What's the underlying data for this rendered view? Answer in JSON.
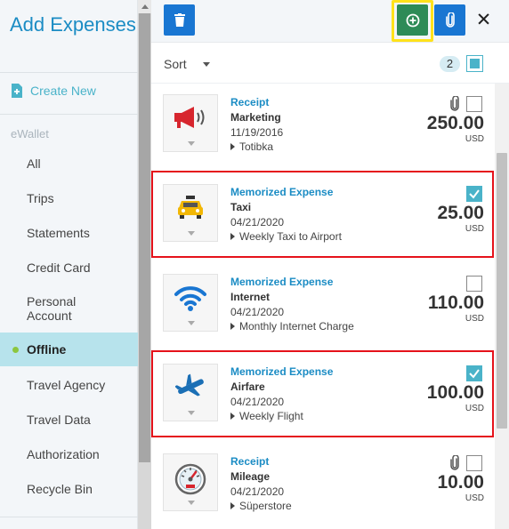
{
  "sidebar": {
    "title": "Add Expenses",
    "create_new": "Create New",
    "section": "eWallet",
    "items": [
      {
        "label": "All"
      },
      {
        "label": "Trips"
      },
      {
        "label": "Statements"
      },
      {
        "label": "Credit Card"
      },
      {
        "label": "Personal Account"
      },
      {
        "label": "Offline",
        "active": true
      },
      {
        "label": "Travel Agency"
      },
      {
        "label": "Travel Data"
      },
      {
        "label": "Authorization"
      },
      {
        "label": "Recycle Bin"
      }
    ]
  },
  "toolbar": {
    "icons": [
      "trash-icon",
      "add-icon",
      "paperclip-icon",
      "close-icon"
    ],
    "close_glyph": "✕"
  },
  "sortbar": {
    "sort_label": "Sort",
    "selected_count": "2"
  },
  "expenses": [
    {
      "type": "Receipt",
      "name": "Marketing",
      "date": "11/19/2016",
      "detail": "Totibka",
      "amount": "250.00",
      "currency": "USD",
      "checked": false,
      "attachment": true,
      "icon": "megaphone-icon"
    },
    {
      "type": "Memorized Expense",
      "name": "Taxi",
      "date": "04/21/2020",
      "detail": "Weekly Taxi to Airport",
      "amount": "25.00",
      "currency": "USD",
      "checked": true,
      "attachment": false,
      "icon": "taxi-icon"
    },
    {
      "type": "Memorized Expense",
      "name": "Internet",
      "date": "04/21/2020",
      "detail": "Monthly Internet Charge",
      "amount": "110.00",
      "currency": "USD",
      "checked": false,
      "attachment": false,
      "icon": "wifi-icon"
    },
    {
      "type": "Memorized Expense",
      "name": "Airfare",
      "date": "04/21/2020",
      "detail": "Weekly Flight",
      "amount": "100.00",
      "currency": "USD",
      "checked": true,
      "attachment": false,
      "icon": "airplane-icon"
    },
    {
      "type": "Receipt",
      "name": "Mileage",
      "date": "04/21/2020",
      "detail": "Süperstore",
      "amount": "10.00",
      "currency": "USD",
      "checked": false,
      "attachment": true,
      "icon": "speedometer-icon"
    }
  ],
  "colors": {
    "accent": "#1b8cc4",
    "primary_button": "#1976d2",
    "add_button": "#2e8b57",
    "highlight_outline": "#ffe21a",
    "selection_outline": "#e5121b",
    "checkbox_on": "#4ab3c9",
    "active_item_bg": "#b7e3ec"
  }
}
